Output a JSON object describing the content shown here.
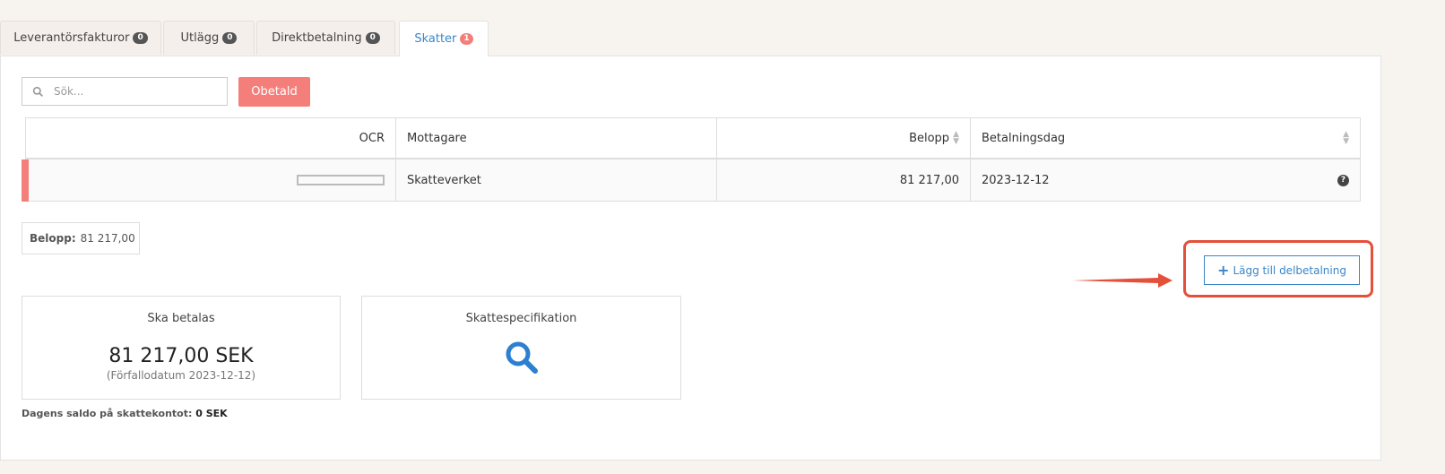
{
  "tabs": [
    {
      "label": "Leverantörsfakturor",
      "badge": "0"
    },
    {
      "label": "Utlägg",
      "badge": "0"
    },
    {
      "label": "Direktbetalning",
      "badge": "0"
    },
    {
      "label": "Skatter",
      "badge": "1"
    }
  ],
  "search": {
    "placeholder": "Sök..."
  },
  "filter_button": "Obetald",
  "table": {
    "headers": {
      "ocr": "OCR",
      "mottagare": "Mottagare",
      "belopp": "Belopp",
      "betalningsdag": "Betalningsdag"
    },
    "rows": [
      {
        "ocr": "",
        "mottagare": "Skatteverket",
        "belopp": "81 217,00",
        "betalningsdag": "2023-12-12"
      }
    ]
  },
  "summary": {
    "label": "Belopp:",
    "value": "81 217,00"
  },
  "add_button": "Lägg till delbetalning",
  "cards": {
    "ska_betalas": {
      "title": "Ska betalas",
      "amount": "81 217,00 SEK",
      "due": "(Förfallodatum 2023-12-12)"
    },
    "skattespecifikation": {
      "title": "Skattespecifikation"
    }
  },
  "saldo": {
    "label": "Dagens saldo på skattekontot:",
    "value": "0 SEK"
  },
  "colors": {
    "accent": "#3a86c8",
    "danger": "#f47f7a",
    "highlight": "#e4503a"
  }
}
